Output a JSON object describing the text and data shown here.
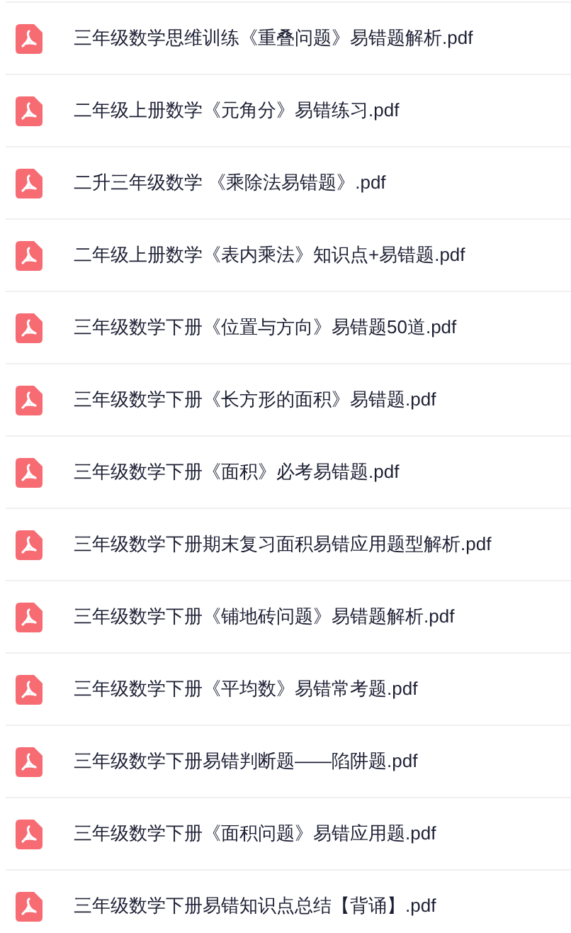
{
  "files": [
    {
      "name": "三年级数学思维训练《重叠问题》易错题解析.pdf"
    },
    {
      "name": "二年级上册数学《元角分》易错练习.pdf"
    },
    {
      "name": "二升三年级数学 《乘除法易错题》.pdf"
    },
    {
      "name": "二年级上册数学《表内乘法》知识点+易错题.pdf"
    },
    {
      "name": "三年级数学下册《位置与方向》易错题50道.pdf"
    },
    {
      "name": "三年级数学下册《长方形的面积》易错题.pdf"
    },
    {
      "name": "三年级数学下册《面积》必考易错题.pdf"
    },
    {
      "name": "三年级数学下册期末复习面积易错应用题型解析.pdf"
    },
    {
      "name": "三年级数学下册《铺地砖问题》易错题解析.pdf"
    },
    {
      "name": "三年级数学下册《平均数》易错常考题.pdf"
    },
    {
      "name": "三年级数学下册易错判断题——陷阱题.pdf"
    },
    {
      "name": "三年级数学下册《面积问题》易错应用题.pdf"
    },
    {
      "name": "三年级数学下册易错知识点总结【背诵】.pdf"
    }
  ]
}
